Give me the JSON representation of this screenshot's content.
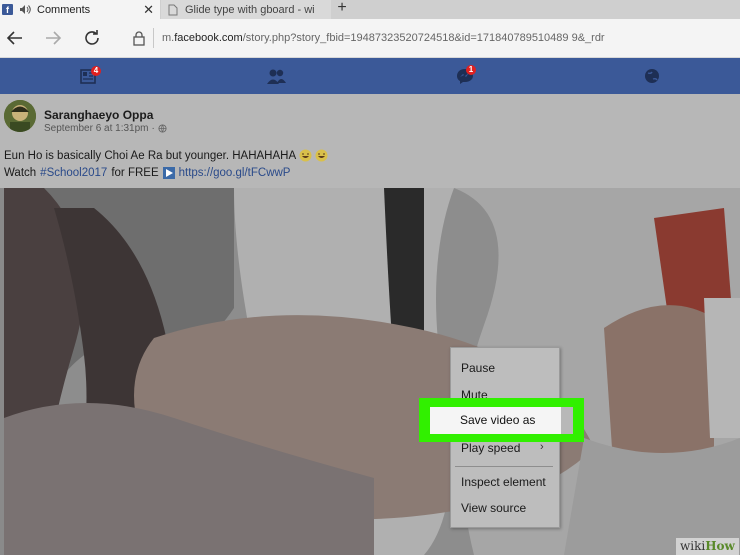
{
  "browser": {
    "tabs": [
      {
        "title": "Comments",
        "active": true
      },
      {
        "title": "Glide type with gboard - wi",
        "active": false
      }
    ],
    "url_prefix": "m.",
    "url_domain": "facebook.com",
    "url_path": "/story.php?story_fbid=19487323520724518&id=171840789510489 9&_rdr"
  },
  "fb_nav": {
    "feed_badge": "4",
    "messages_badge": "1",
    "icons": [
      "news-feed-icon",
      "friend-requests-icon",
      "messages-icon",
      "notifications-globe-icon"
    ],
    "brand_color": "#3b5998"
  },
  "post": {
    "author": "Saranghaeyo Oppa",
    "timestamp": "September 6 at 1:31pm",
    "dot": "·",
    "text_line1": "Eun Ho is basically Choi Ae Ra but younger. HAHAHAHA",
    "text_line2_prefix": "Watch",
    "hashtag": "#School2017",
    "text_line2_mid": "for FREE",
    "link": "https://goo.gl/tFCwwP"
  },
  "context_menu": {
    "items": [
      "Pause",
      "Mute",
      "Save video as",
      "Play speed",
      "Inspect element",
      "View source"
    ],
    "highlight_color": "#31f000"
  },
  "watermark": {
    "prefix": "wiki",
    "suffix": "How"
  }
}
